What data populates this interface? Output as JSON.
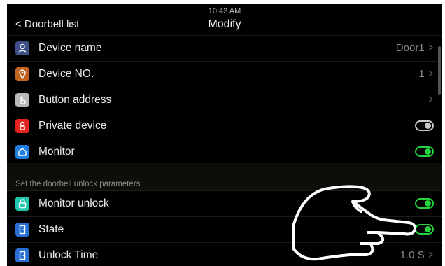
{
  "header": {
    "back_label": "< Doorbell list",
    "time": "10:42 AM",
    "title": "Modify"
  },
  "settings": [
    {
      "label": "Device name",
      "value": "Door1",
      "icon": "person-icon",
      "color": "#3f4f8a"
    },
    {
      "label": "Device NO.",
      "value": "1",
      "icon": "location-pin-icon",
      "color": "#c0641f"
    },
    {
      "label": "Button address",
      "value": "",
      "icon": "hand-pointer-icon",
      "color": "#b8b8b8"
    },
    {
      "label": "Private device",
      "toggle": "off",
      "icon": "private-icon",
      "color": "#e5231f"
    },
    {
      "label": "Monitor",
      "toggle": "on",
      "icon": "monitor-home-icon",
      "color": "#1f7fe0"
    }
  ],
  "section_header": "Set the doorbell unlock parameters",
  "unlock_settings": [
    {
      "label": "Monitor unlock",
      "toggle": "on",
      "icon": "lock-icon",
      "color": "#23c7b0"
    },
    {
      "label": "State",
      "toggle": "on",
      "icon": "door-icon",
      "color": "#2a6fd6"
    },
    {
      "label": "Unlock Time",
      "value": "1.0 S",
      "icon": "door-icon",
      "color": "#2a6fd6"
    }
  ],
  "colors": {
    "toggle_on": "#23d43f",
    "toggle_off": "#c8c8c8",
    "background": "#000000"
  }
}
